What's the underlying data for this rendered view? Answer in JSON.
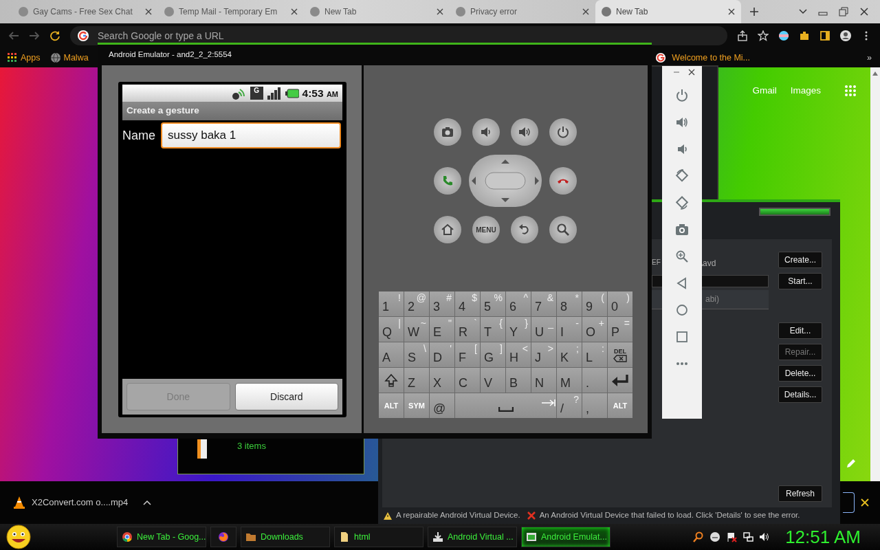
{
  "browser": {
    "tabs": [
      {
        "title": "Gay Cams - Free Sex Chat",
        "selected": false
      },
      {
        "title": "Temp Mail - Temporary Em",
        "selected": false
      },
      {
        "title": "New Tab",
        "selected": false
      },
      {
        "title": "Privacy error",
        "selected": false
      },
      {
        "title": "New Tab",
        "selected": true
      }
    ],
    "address": {
      "placeholder": "Search Google or type a URL"
    },
    "bookmarks": [
      "Apps",
      "Malwa"
    ],
    "bookmark_right": "Welcome to the Mi...",
    "bookmarks_more": "»",
    "header_links": [
      "Gmail",
      "Images"
    ],
    "download": {
      "file": "X2Convert.com o....mp4"
    }
  },
  "emulator": {
    "title": "Android Emulator - and2_2_2:5554",
    "network": "G",
    "clock": "4:53",
    "clock_suffix": "AM",
    "screen_title": "Create a gesture",
    "name_label": "Name",
    "name_value": "sussy baka 1",
    "buttons": [
      {
        "label": "Done",
        "disabled": true
      },
      {
        "label": "Discard",
        "disabled": false
      }
    ],
    "menu_key": "MENU",
    "keyboard": [
      [
        {
          "kind": "char",
          "main": "1",
          "alt": "!"
        },
        {
          "kind": "char",
          "main": "2",
          "alt": "@"
        },
        {
          "kind": "char",
          "main": "3",
          "alt": "#"
        },
        {
          "kind": "char",
          "main": "4",
          "alt": "$"
        },
        {
          "kind": "char",
          "main": "5",
          "alt": "%"
        },
        {
          "kind": "char",
          "main": "6",
          "alt": "^"
        },
        {
          "kind": "char",
          "main": "7",
          "alt": "&"
        },
        {
          "kind": "char",
          "main": "8",
          "alt": "*"
        },
        {
          "kind": "char",
          "main": "9",
          "alt": "("
        },
        {
          "kind": "char",
          "main": "0",
          "alt": ")"
        }
      ],
      [
        {
          "kind": "char",
          "main": "Q",
          "alt": "|"
        },
        {
          "kind": "char",
          "main": "W",
          "alt": "~"
        },
        {
          "kind": "char",
          "main": "E",
          "alt": "\""
        },
        {
          "kind": "char",
          "main": "R",
          "alt": "`"
        },
        {
          "kind": "char",
          "main": "T",
          "alt": "{"
        },
        {
          "kind": "char",
          "main": "Y",
          "alt": "}"
        },
        {
          "kind": "char",
          "main": "U",
          "alt": "_"
        },
        {
          "kind": "char",
          "main": "I",
          "alt": "-"
        },
        {
          "kind": "char",
          "main": "O",
          "alt": "+"
        },
        {
          "kind": "char",
          "main": "P",
          "alt": "="
        }
      ],
      [
        {
          "kind": "char",
          "main": "A"
        },
        {
          "kind": "char",
          "main": "S",
          "alt": "\\"
        },
        {
          "kind": "char",
          "main": "D",
          "alt": "'"
        },
        {
          "kind": "char",
          "main": "F",
          "alt": "["
        },
        {
          "kind": "char",
          "main": "G",
          "alt": "]"
        },
        {
          "kind": "char",
          "main": "H",
          "alt": "<"
        },
        {
          "kind": "char",
          "main": "J",
          "alt": ">"
        },
        {
          "kind": "char",
          "main": "K",
          "alt": ";"
        },
        {
          "kind": "char",
          "main": "L",
          "alt": ":"
        },
        {
          "kind": "del",
          "main": "DEL"
        }
      ],
      [
        {
          "kind": "shift"
        },
        {
          "kind": "char",
          "main": "Z"
        },
        {
          "kind": "char",
          "main": "X"
        },
        {
          "kind": "char",
          "main": "C"
        },
        {
          "kind": "char",
          "main": "V"
        },
        {
          "kind": "char",
          "main": "B"
        },
        {
          "kind": "char",
          "main": "N"
        },
        {
          "kind": "char",
          "main": "M"
        },
        {
          "kind": "char",
          "main": "."
        },
        {
          "kind": "enter"
        }
      ],
      [
        {
          "kind": "mod",
          "main": "ALT"
        },
        {
          "kind": "mod",
          "main": "SYM"
        },
        {
          "kind": "char",
          "main": "@"
        },
        {
          "kind": "space"
        },
        {
          "kind": "char",
          "main": "/",
          "alt": "?"
        },
        {
          "kind": "char",
          "main": ","
        },
        {
          "kind": "mod",
          "main": "ALT"
        }
      ]
    ]
  },
  "file_window": {
    "status": "3 items"
  },
  "avd_manager": {
    "path_fragments": [
      "EF",
      "\\avd"
    ],
    "list_fragment": "abi)",
    "buttons_top": [
      {
        "label": "Create...",
        "disabled": false
      },
      {
        "label": "Start...",
        "disabled": false
      }
    ],
    "buttons_mid": [
      {
        "label": "Edit...",
        "disabled": false
      },
      {
        "label": "Repair...",
        "disabled": true
      },
      {
        "label": "Delete...",
        "disabled": false
      },
      {
        "label": "Details...",
        "disabled": false
      }
    ],
    "refresh": "Refresh",
    "legend": [
      {
        "kind": "warning",
        "text": "A repairable Android Virtual Device."
      },
      {
        "kind": "error",
        "text": "An Android Virtual Device that failed to load. Click 'Details' to see the error."
      }
    ]
  },
  "taskbar": {
    "items": [
      {
        "label": "New Tab - Goog...",
        "selected": false
      },
      {
        "selected": false
      },
      {
        "label": "Downloads",
        "selected": false
      },
      {
        "label": "html",
        "selected": false
      },
      {
        "label": "Android Virtual ...",
        "selected": false
      },
      {
        "label": "Android Emulat...",
        "selected": true
      }
    ],
    "clock": "12:51 AM"
  }
}
